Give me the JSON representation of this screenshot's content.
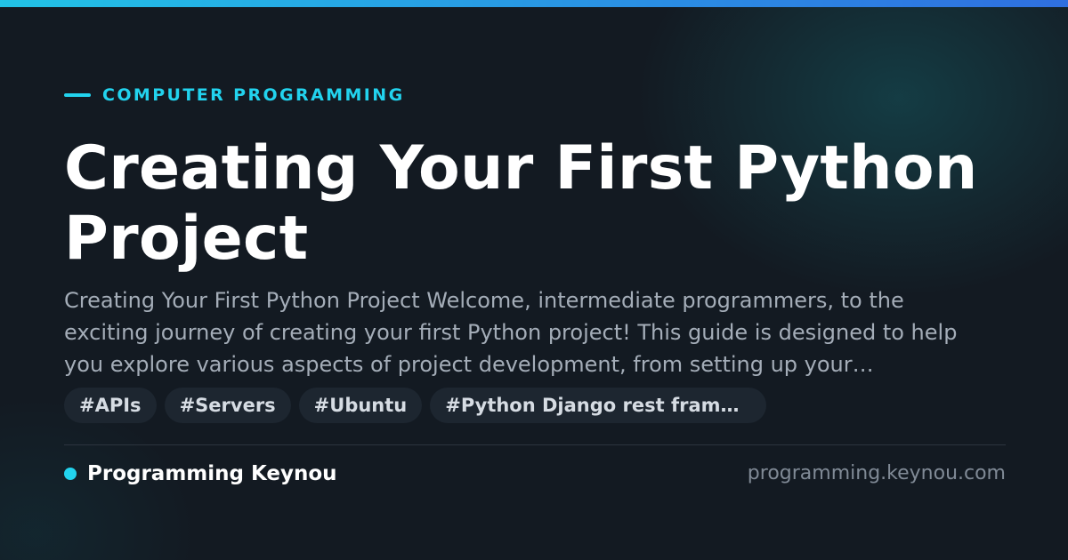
{
  "colors": {
    "accent": "#22d3ee",
    "background": "#131a22",
    "title": "#ffffff",
    "excerpt": "#a4adb8",
    "tag_bg": "#1d2630"
  },
  "card": {
    "category": "COMPUTER PROGRAMMING",
    "title": "Creating Your First Python Project",
    "excerpt": "Creating Your First Python Project Welcome, intermediate programmers, to the exciting journey of creating your first Python project! This guide is designed to help you explore various aspects of project development, from setting up your environment to deploying your application.",
    "tags": [
      "#APIs",
      "#Servers",
      "#Ubuntu",
      "#Python Django rest framework"
    ]
  },
  "footer": {
    "brand": "Programming Keynou",
    "url": "programming.keynou.com"
  }
}
